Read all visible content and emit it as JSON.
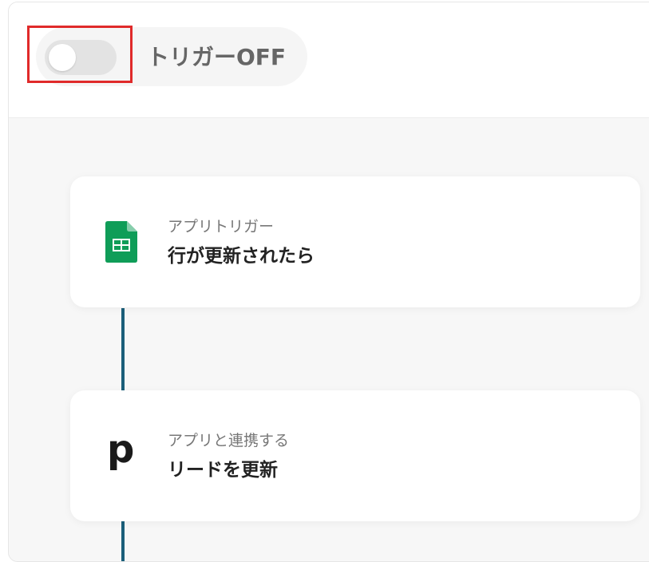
{
  "header": {
    "trigger_status_label": "トリガーOFF",
    "toggle_state": "off"
  },
  "flow": {
    "steps": [
      {
        "subtitle": "アプリトリガー",
        "title": "行が更新されたら",
        "icon": "google-sheets-icon"
      },
      {
        "subtitle": "アプリと連携する",
        "title": "リードを更新",
        "icon": "p-letter-icon",
        "icon_glyph": "p"
      }
    ]
  },
  "colors": {
    "toggle_highlight": "#e02a2a",
    "connector": "#1b5f7a",
    "sheets_green": "#0f9d58"
  }
}
